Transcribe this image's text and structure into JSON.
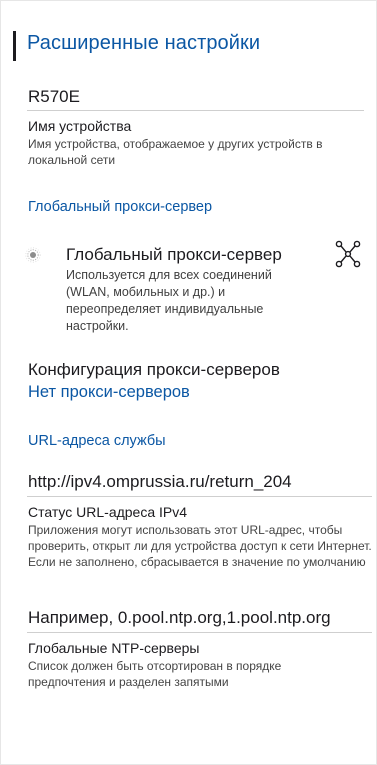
{
  "header": {
    "title": "Расширенные настройки"
  },
  "device_name": {
    "value": "R570E",
    "label": "Имя устройства",
    "description": "Имя устройства, отображаемое у других устройств в локальной сети"
  },
  "proxy_section": {
    "header": "Глобальный прокси-сервер",
    "toggle": {
      "title": "Глобальный прокси-сервер",
      "summary": "Используется для всех соединений (WLAN, мобильных и др.) и переопределяет индивидуальные настройки.",
      "icon": "proxy-network-icon",
      "state": "off"
    },
    "config": {
      "title": "Конфигурация прокси-серверов",
      "summary": "Нет прокси-серверов"
    }
  },
  "url_section": {
    "header": "URL-адреса службы",
    "ipv4_status": {
      "value": "http://ipv4.omprussia.ru/return_204",
      "label": "Статус URL-адреса IPv4",
      "description": "Приложения могут использовать этот URL-адрес, чтобы проверить, открыт ли для устройства доступ к сети Интернет. Если не заполнено, сбрасывается в значение по умолчанию"
    },
    "ntp": {
      "placeholder": "Например, 0.pool.ntp.org,1.pool.ntp.org",
      "label": "Глобальные NTP-серверы",
      "description": "Список должен быть отсортирован в порядке предпочтения и разделен запятыми"
    }
  },
  "colors": {
    "accent": "#0b57a4",
    "text": "#1c1b1f",
    "secondary": "#444444"
  }
}
